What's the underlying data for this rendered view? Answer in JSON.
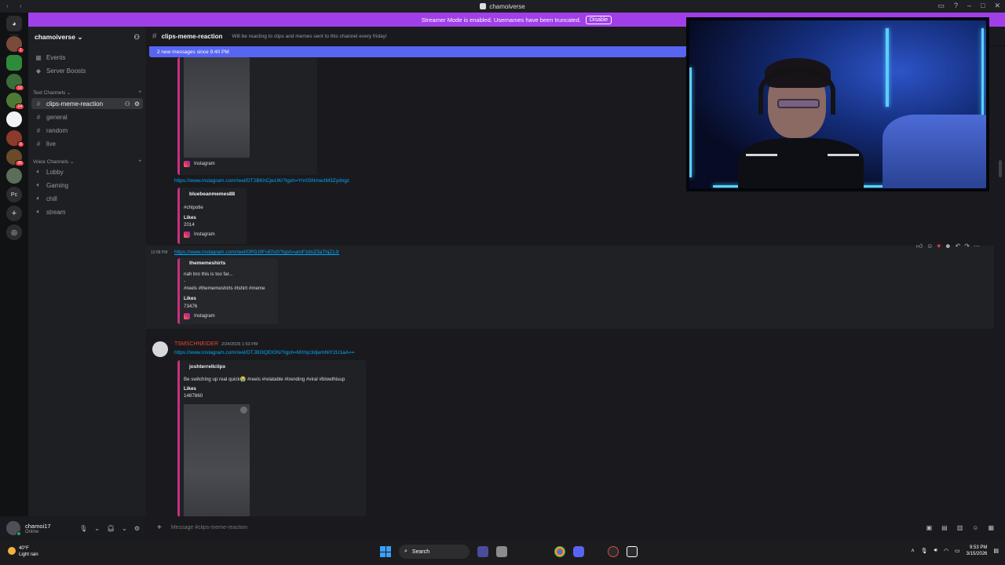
{
  "window": {
    "title": "chamoiverse"
  },
  "banner": {
    "text": "Streamer Mode is enabled. Usernames have been truncated.",
    "button": "Disable"
  },
  "rail": {
    "badges": [
      "1",
      "12",
      "24",
      "6",
      "36"
    ]
  },
  "sidebar": {
    "server_name": "chamoiverse",
    "top_items": [
      {
        "label": "Events",
        "icon": "calendar-icon"
      },
      {
        "label": "Server Boosts",
        "icon": "boost-icon"
      }
    ],
    "text_category": "Text Channels",
    "text_channels": [
      {
        "label": "clips-meme-reaction",
        "active": true
      },
      {
        "label": "general"
      },
      {
        "label": "random"
      },
      {
        "label": "live"
      }
    ],
    "voice_category": "Voice Channels",
    "voice_channels": [
      {
        "label": "Lobby"
      },
      {
        "label": "Gaming"
      },
      {
        "label": "chill"
      },
      {
        "label": "stream"
      }
    ]
  },
  "user_panel": {
    "name": "chamoi17",
    "status": "Online"
  },
  "channel": {
    "name": "clips-meme-reaction",
    "topic": "Will be reacting to clips and memes sent to this channel every friday!",
    "new_messages": "2 new messages since 9:40 PM"
  },
  "messages": {
    "embed1": {
      "footer": "Instagram"
    },
    "link2": "https://www.instagram.com/reel/DT2BKhCjwUK/?igsh=Ym03NmwzM3Zydngz",
    "embed2": {
      "author": "bluebeanmemes88",
      "text": "#chipotle",
      "likes_label": "Likes",
      "likes": "2014",
      "footer": "Instagram"
    },
    "time3": "12:58 PM",
    "link3": "https://www.instagram.com/reel/DR9J9FoEfs0/?igsh=amFzdnZ3aThjZzJr",
    "embed3": {
      "author": "thememeshirts",
      "text1": "nah bro this is too far...",
      "text2": "-",
      "text3": "#reels #thememeshirts #tshirt #meme",
      "likes_label": "Likes",
      "likes": "73476",
      "footer": "Instagram"
    },
    "msg4": {
      "author": "TSMSCHNEIDER",
      "date": "2/24/2026 1:53 PM",
      "link": "https://www.instagram.com/reel/DTJBI3QEIGN/?igsh=MXhjc3djemNiY2U1aA==",
      "embed_author": "joshterrellclipx",
      "embed_text": "Be switching up real quick😭 #reels #relatable #trending #viral #blowthisup",
      "likes_label": "Likes",
      "likes": "1487860"
    }
  },
  "composer": {
    "placeholder": "Message #clips-meme-reaction"
  },
  "taskbar": {
    "weather_temp": "40°F",
    "weather_desc": "Light rain",
    "search": "Search",
    "time": "9:53 PM",
    "date": "3/15/2026"
  },
  "colors": {
    "accent": "#5865f2",
    "banner": "#a03fe8",
    "embed_border": "#c5307f",
    "link": "#00a8fc"
  }
}
